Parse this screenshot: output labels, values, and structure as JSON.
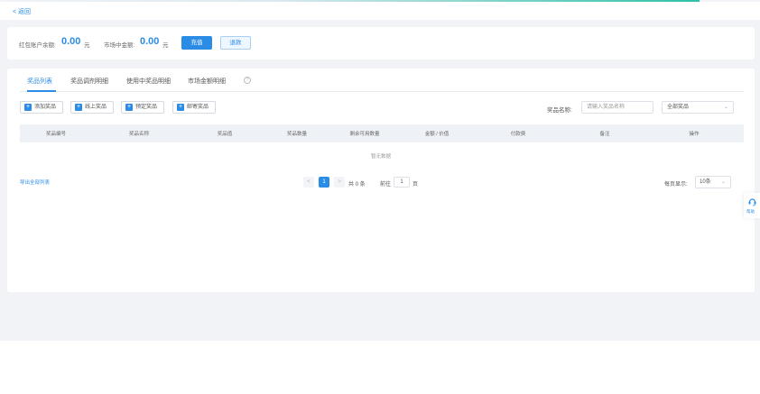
{
  "topbar": {
    "back_label": "< 返回"
  },
  "balance": {
    "redpacket_label": "红包账户余额:",
    "redpacket_value": "0.00",
    "redpacket_unit": "元",
    "market_label": "市场中金额:",
    "market_value": "0.00",
    "market_unit": "元",
    "recharge_label": "充值",
    "withdraw_label": "退款"
  },
  "tabs": [
    {
      "label": "奖品列表"
    },
    {
      "label": "奖品调剂明细"
    },
    {
      "label": "使用中奖品明细"
    },
    {
      "label": "市场金额明细"
    }
  ],
  "toolbar": {
    "buttons": [
      {
        "label": "添加奖品"
      },
      {
        "label": "线上奖品"
      },
      {
        "label": "预定奖品"
      },
      {
        "label": "邮寄奖品"
      }
    ],
    "filter_label": "奖品名称:",
    "search_placeholder": "请输入奖品名称",
    "select_value": "全部奖品"
  },
  "table": {
    "columns": [
      "奖品编号",
      "奖品名称",
      "奖品值",
      "奖品数量",
      "剩余可用数量",
      "金额 / 价值",
      "付款费",
      "备注",
      "操作"
    ],
    "empty_text": "暂无数据"
  },
  "footer": {
    "export_label": "导出全部列表",
    "prev": "<",
    "current_page": "1",
    "next": ">",
    "total_text": "共 0 条",
    "goto_label": "前往",
    "goto_value": "1",
    "goto_unit": "页",
    "page_size_label": "每页显示:",
    "page_size_value": "10条"
  },
  "side_widget": {
    "label": "帮助"
  },
  "icons": {
    "help": "help-circle-icon",
    "plus": "plus-icon",
    "chevron": "chevron-down-icon",
    "support": "support-icon"
  },
  "colors": {
    "accent": "#2b8ce5",
    "header_bg": "#eef1f5",
    "page_bg": "#f1f3f6"
  }
}
